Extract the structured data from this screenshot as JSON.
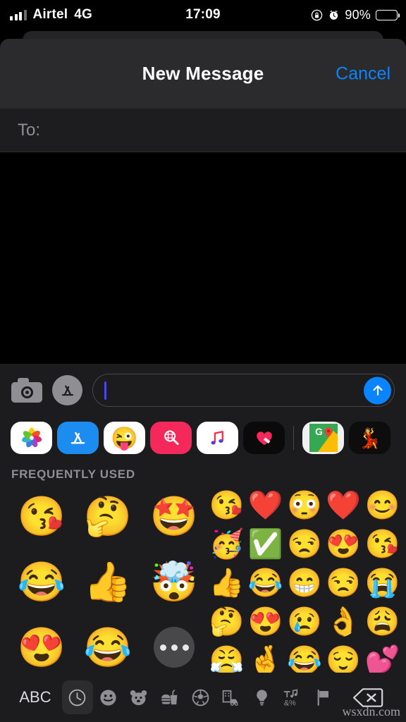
{
  "status_bar": {
    "carrier": "Airtel",
    "network": "4G",
    "time": "17:09",
    "battery_percent": "90%",
    "icons": [
      "signal-bars-icon",
      "rotation-lock-icon",
      "alarm-clock-icon",
      "battery-icon"
    ]
  },
  "navbar": {
    "title": "New Message",
    "cancel_label": "Cancel",
    "accent_color": "#0a84ff"
  },
  "recipient": {
    "label": "To:",
    "value": "",
    "placeholder": ""
  },
  "input_bar": {
    "camera_icon": "camera-icon",
    "appstore_icon": "app-store-icon",
    "message_value": "",
    "message_placeholder": "",
    "send_icon": "send-arrow-icon",
    "send_color": "#0a84ff"
  },
  "app_drawer": {
    "apps": [
      {
        "name": "photos-app",
        "label": "Photos"
      },
      {
        "name": "app-store-app",
        "label": "App Store"
      },
      {
        "name": "memoji-stickers-app",
        "label": "Memoji Stickers"
      },
      {
        "name": "images-search-app",
        "label": "#images"
      },
      {
        "name": "apple-music-app",
        "label": "Music"
      },
      {
        "name": "digital-touch-app",
        "label": "Digital Touch"
      },
      {
        "name": "google-maps-app",
        "label": "Google Maps"
      },
      {
        "name": "partial-app",
        "label": ""
      }
    ]
  },
  "emoji_panel": {
    "section_header": "FREQUENTLY USED",
    "memoji": [
      {
        "glyph": "😘",
        "name": "memoji-kiss-heart"
      },
      {
        "glyph": "🤔",
        "name": "memoji-thinking"
      },
      {
        "glyph": "🤩",
        "name": "memoji-star-struck"
      },
      {
        "glyph": "😂",
        "name": "memoji-joy"
      },
      {
        "glyph": "👍",
        "name": "memoji-thumbs-up"
      },
      {
        "glyph": "🤯",
        "name": "memoji-mind-blown"
      },
      {
        "glyph": "😍",
        "name": "memoji-heart-eyes"
      },
      {
        "glyph": "😂",
        "name": "memoji-laughing-tears"
      }
    ],
    "more_button_label": "•••",
    "emoji": [
      {
        "glyph": "😘",
        "name": "emoji-face-blowing-kiss"
      },
      {
        "glyph": "❤️",
        "name": "emoji-red-heart"
      },
      {
        "glyph": "😳",
        "name": "emoji-flushed-face"
      },
      {
        "glyph": "❤️",
        "name": "emoji-red-heart"
      },
      {
        "glyph": "😊",
        "name": "emoji-smiling-face-smiling-eyes"
      },
      {
        "glyph": "🥳",
        "name": "emoji-partying-face"
      },
      {
        "glyph": "✅",
        "name": "emoji-check-mark-button"
      },
      {
        "glyph": "😒",
        "name": "emoji-unamused-face"
      },
      {
        "glyph": "😍",
        "name": "emoji-heart-eyes"
      },
      {
        "glyph": "😘",
        "name": "emoji-face-blowing-kiss"
      },
      {
        "glyph": "👍",
        "name": "emoji-thumbs-up"
      },
      {
        "glyph": "😂",
        "name": "emoji-face-with-tears-of-joy"
      },
      {
        "glyph": "😁",
        "name": "emoji-beaming-face"
      },
      {
        "glyph": "😒",
        "name": "emoji-unamused-face"
      },
      {
        "glyph": "😭",
        "name": "emoji-loudly-crying-face"
      },
      {
        "glyph": "🤔",
        "name": "emoji-thinking-face"
      },
      {
        "glyph": "😍",
        "name": "emoji-heart-eyes"
      },
      {
        "glyph": "😢",
        "name": "emoji-crying-face"
      },
      {
        "glyph": "👌",
        "name": "emoji-ok-hand"
      },
      {
        "glyph": "😩",
        "name": "emoji-weary-face"
      },
      {
        "glyph": "😤",
        "name": "emoji-face-with-steam"
      },
      {
        "glyph": "🤞",
        "name": "emoji-crossed-fingers"
      },
      {
        "glyph": "😂",
        "name": "emoji-face-with-tears-of-joy"
      },
      {
        "glyph": "😌",
        "name": "emoji-relieved-face"
      },
      {
        "glyph": "💕",
        "name": "emoji-two-hearts"
      }
    ]
  },
  "tabbar": {
    "abc_label": "ABC",
    "tabs": [
      {
        "name": "tab-recent",
        "icon": "clock-icon",
        "selected": true
      },
      {
        "name": "tab-smileys",
        "icon": "smiley-icon",
        "selected": false
      },
      {
        "name": "tab-animals",
        "icon": "bear-icon",
        "selected": false
      },
      {
        "name": "tab-food",
        "icon": "food-icon",
        "selected": false
      },
      {
        "name": "tab-activity",
        "icon": "soccer-ball-icon",
        "selected": false
      },
      {
        "name": "tab-travel",
        "icon": "car-building-icon",
        "selected": false
      },
      {
        "name": "tab-objects",
        "icon": "lightbulb-icon",
        "selected": false
      },
      {
        "name": "tab-symbols",
        "icon": "symbols-icon",
        "selected": false
      },
      {
        "name": "tab-flags",
        "icon": "flag-icon",
        "selected": false
      }
    ],
    "delete_icon": "backspace-delete-icon"
  },
  "watermark": {
    "text": "wsxdn.com"
  }
}
